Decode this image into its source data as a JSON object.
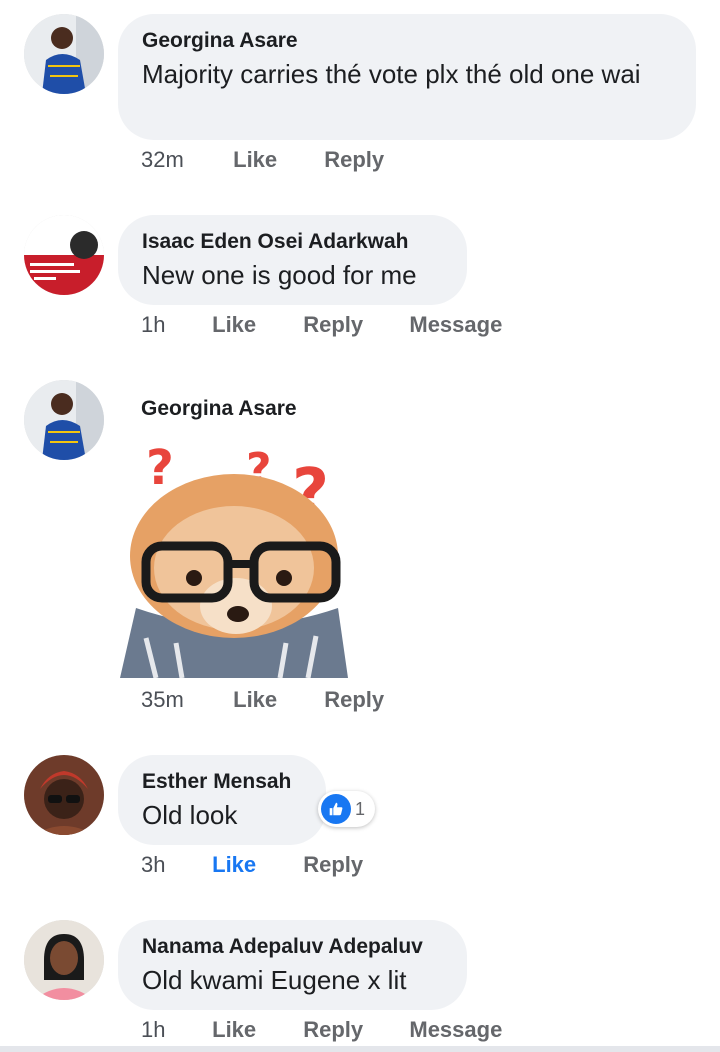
{
  "comments": [
    {
      "author": "Georgina Asare",
      "text": "Majority carries thé vote plx thé old one wai",
      "time": "32m",
      "like": "Like",
      "reply": "Reply"
    },
    {
      "author": "Isaac Eden Osei Adarkwah",
      "text": "New one is good for me",
      "time": "1h",
      "like": "Like",
      "reply": "Reply",
      "message": "Message"
    },
    {
      "author": "Georgina Asare",
      "sticker": "pomeranian-with-glasses-question-marks",
      "time": "35m",
      "like": "Like",
      "reply": "Reply"
    },
    {
      "author": "Esther Mensah",
      "text": "Old look",
      "reaction_count": "1",
      "time": "3h",
      "like": "Like",
      "like_active": true,
      "reply": "Reply"
    },
    {
      "author": "Nanama Adepaluv Adepaluv",
      "text": "Old kwami Eugene x lit",
      "time": "1h",
      "like": "Like",
      "reply": "Reply",
      "message": "Message"
    }
  ],
  "colors": {
    "bubble": "#f0f2f5",
    "meta": "#65676b",
    "like_active": "#1877f2",
    "question_mark": "#e8453c"
  },
  "icons": {
    "reaction": "thumbs-up-icon"
  }
}
